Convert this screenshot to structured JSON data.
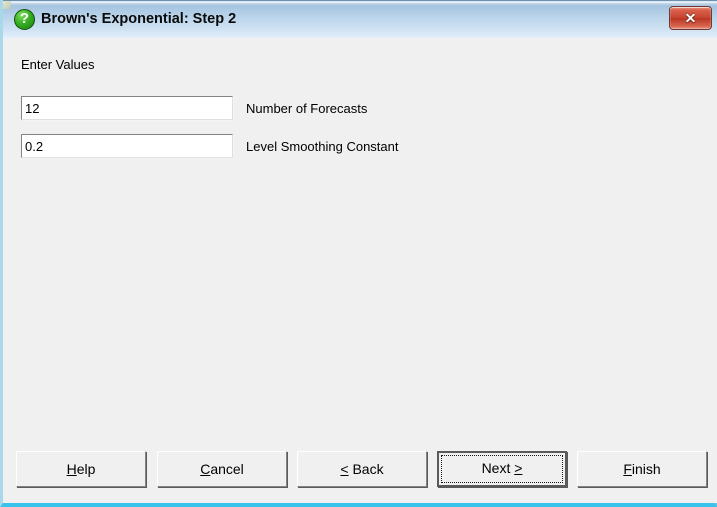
{
  "window": {
    "title": "Brown's Exponential: Step 2",
    "title_icon": "question-mark-icon",
    "close_glyph": "✕",
    "accent_colors": {
      "titlebar_top": "#8fb4d6",
      "titlebar_bottom": "#e3eef8",
      "client_background": "#f0f0f0",
      "aero_border": "#37c3ec",
      "close_button_red": "#c5432f",
      "help_icon_green": "#36b022"
    }
  },
  "form": {
    "section_label": "Enter Values",
    "fields": [
      {
        "value": "12",
        "label": "Number of Forecasts",
        "placeholder": ""
      },
      {
        "value": "0.2",
        "label": "Level Smoothing Constant",
        "placeholder": ""
      }
    ]
  },
  "buttons": [
    {
      "id": "help",
      "mnemonic": "H",
      "before": "",
      "after": "elp",
      "full": "Help"
    },
    {
      "id": "cancel",
      "mnemonic": "C",
      "before": "",
      "after": "ancel",
      "full": "Cancel"
    },
    {
      "id": "back",
      "mnemonic": "<",
      "before": "",
      "after": " Back",
      "full": "< Back"
    },
    {
      "id": "next",
      "mnemonic": ">",
      "before": "Next ",
      "after": "",
      "full": "Next >"
    },
    {
      "id": "finish",
      "mnemonic": "F",
      "before": "",
      "after": "inish",
      "full": "Finish"
    }
  ]
}
